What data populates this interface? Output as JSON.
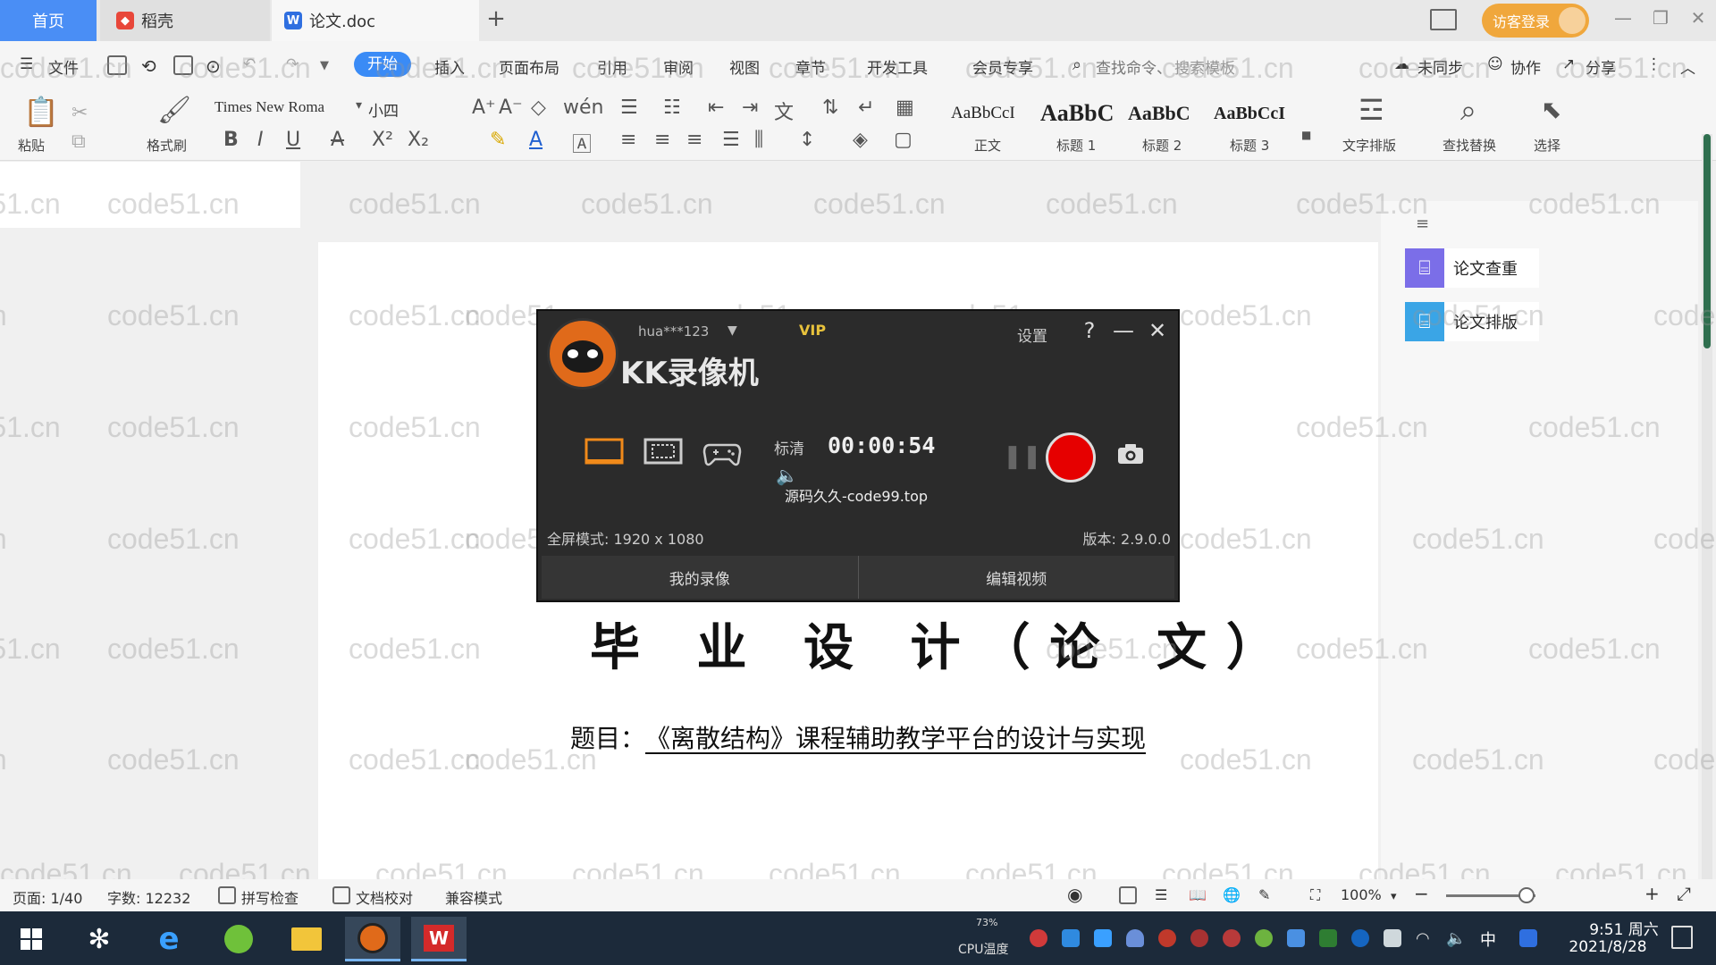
{
  "tabs": {
    "home": "首页",
    "daoke": "稻壳",
    "doc": "论文.doc",
    "new_tab_icon": "plus-icon"
  },
  "header": {
    "visitor_login": "访客登录"
  },
  "menu": {
    "file": "文件",
    "start": "开始",
    "insert": "插入",
    "page_layout": "页面布局",
    "reference": "引用",
    "review": "审阅",
    "view": "视图",
    "chapter": "章节",
    "dev_tools": "开发工具",
    "member": "会员专享",
    "search_command": "查找命令、",
    "search_template": "搜索模板",
    "unsynced": "未同步",
    "collab": "协作",
    "share": "分享"
  },
  "ribbon": {
    "paste": "粘贴",
    "format_painter": "格式刷",
    "font_name": "Times New Roma",
    "font_size": "小四",
    "styles": [
      {
        "sample": "AaBbCcI",
        "label": "正文"
      },
      {
        "sample": "AaBbC",
        "label": "标题 1"
      },
      {
        "sample": "AaBbC",
        "label": "标题 2"
      },
      {
        "sample": "AaBbCcI",
        "label": "标题 3"
      }
    ],
    "text_tools": "文字排版",
    "find_replace": "查找替换",
    "select": "选择"
  },
  "document": {
    "title": "毕 业 设 计（论 文）",
    "subject_label": "题目：",
    "subject": "《离散结构》课程辅助教学平台的设计与实现"
  },
  "right_panel": {
    "items": [
      {
        "label": "论文查重",
        "color": "#7b6ee8"
      },
      {
        "label": "论文排版",
        "color": "#3aa5e6"
      }
    ]
  },
  "recorder": {
    "user": "hua***123",
    "vip": "VIP",
    "title": "KK录像机",
    "settings": "设置",
    "help": "?",
    "quality": "标清",
    "timer": "00:00:54",
    "watermark": "源码久久-code99.top",
    "fullscreen": "全屏模式: 1920 x 1080",
    "version": "版本: 2.9.0.0",
    "my_recordings": "我的录像",
    "edit_video": "编辑视频"
  },
  "status": {
    "page": "页面: 1/40",
    "words": "字数: 12232",
    "spellcheck": "拼写检查",
    "doc_proof": "文档校对",
    "compat": "兼容模式",
    "zoom": "100%",
    "zoom_level": 0.9
  },
  "taskbar": {
    "cpu_value": "73%",
    "cpu_label": "CPU温度",
    "ime": "中",
    "time": "9:51 周六",
    "date": "2021/8/28"
  },
  "watermark_text": "code51.cn",
  "colors": {
    "accent": "#3a8bf6",
    "record": "#e60000",
    "vip": "#e8c23c"
  }
}
